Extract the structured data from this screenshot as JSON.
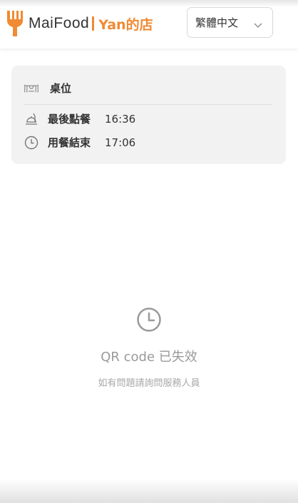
{
  "header": {
    "brand": "MaiFood",
    "store_name": "Yan的店",
    "language": "繁體中文"
  },
  "info": {
    "table_label": "桌位",
    "last_order_label": "最後點餐",
    "last_order_time": "16:36",
    "end_label": "用餐結束",
    "end_time": "17:06"
  },
  "status": {
    "title": "QR code 已失效",
    "subtitle": "如有問題請詢問服務人員"
  },
  "colors": {
    "accent": "#f08a33",
    "card_bg": "#f3f2f2",
    "muted_text": "#9a9a9a"
  },
  "icons": {
    "logo": "fork-knife-logo-icon",
    "language": "chevron-down-icon",
    "table": "table-icon",
    "last_order": "food-tray-icon",
    "end": "clock-icon",
    "expired": "clock-icon"
  }
}
